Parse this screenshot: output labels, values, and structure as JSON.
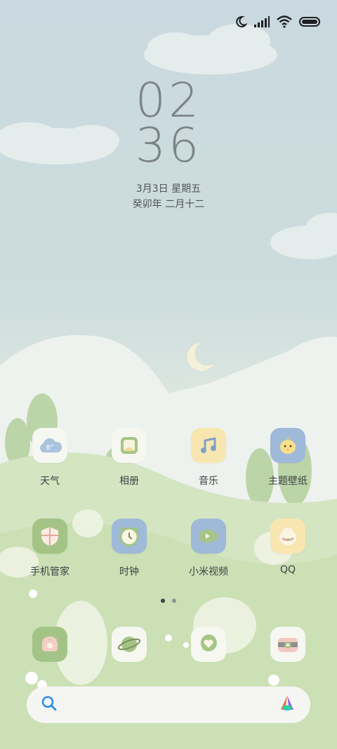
{
  "status": {
    "icons": [
      "moon-icon",
      "signal-icon",
      "wifi-icon",
      "battery-icon"
    ]
  },
  "clock": {
    "hours": "02",
    "minutes": "36"
  },
  "date": {
    "gregorian": "3月3日 星期五",
    "lunar": "癸卯年 二月十二"
  },
  "weather": {
    "temp": "8°"
  },
  "apps": [
    {
      "label": "天气",
      "icon": "weather-icon"
    },
    {
      "label": "相册",
      "icon": "gallery-icon"
    },
    {
      "label": "音乐",
      "icon": "music-icon"
    },
    {
      "label": "主题壁纸",
      "icon": "themes-icon"
    },
    {
      "label": "手机管家",
      "icon": "security-icon"
    },
    {
      "label": "时钟",
      "icon": "clock-icon"
    },
    {
      "label": "小米视频",
      "icon": "video-icon"
    },
    {
      "label": "QQ",
      "icon": "qq-icon"
    }
  ],
  "dock": [
    {
      "icon": "phone-icon"
    },
    {
      "icon": "browser-icon"
    },
    {
      "icon": "messages-icon"
    },
    {
      "icon": "camera-icon"
    }
  ],
  "pages": {
    "count": 2,
    "current": 1
  },
  "search": {
    "icons": [
      "search-icon",
      "assistant-icon"
    ]
  },
  "colors": {
    "accent_green": "#9bbf7b",
    "accent_blue": "#9fb9d8",
    "accent_yellow": "#f6e3a6",
    "dot_active": "#3d4244",
    "dot_inactive": "#8d9291"
  }
}
